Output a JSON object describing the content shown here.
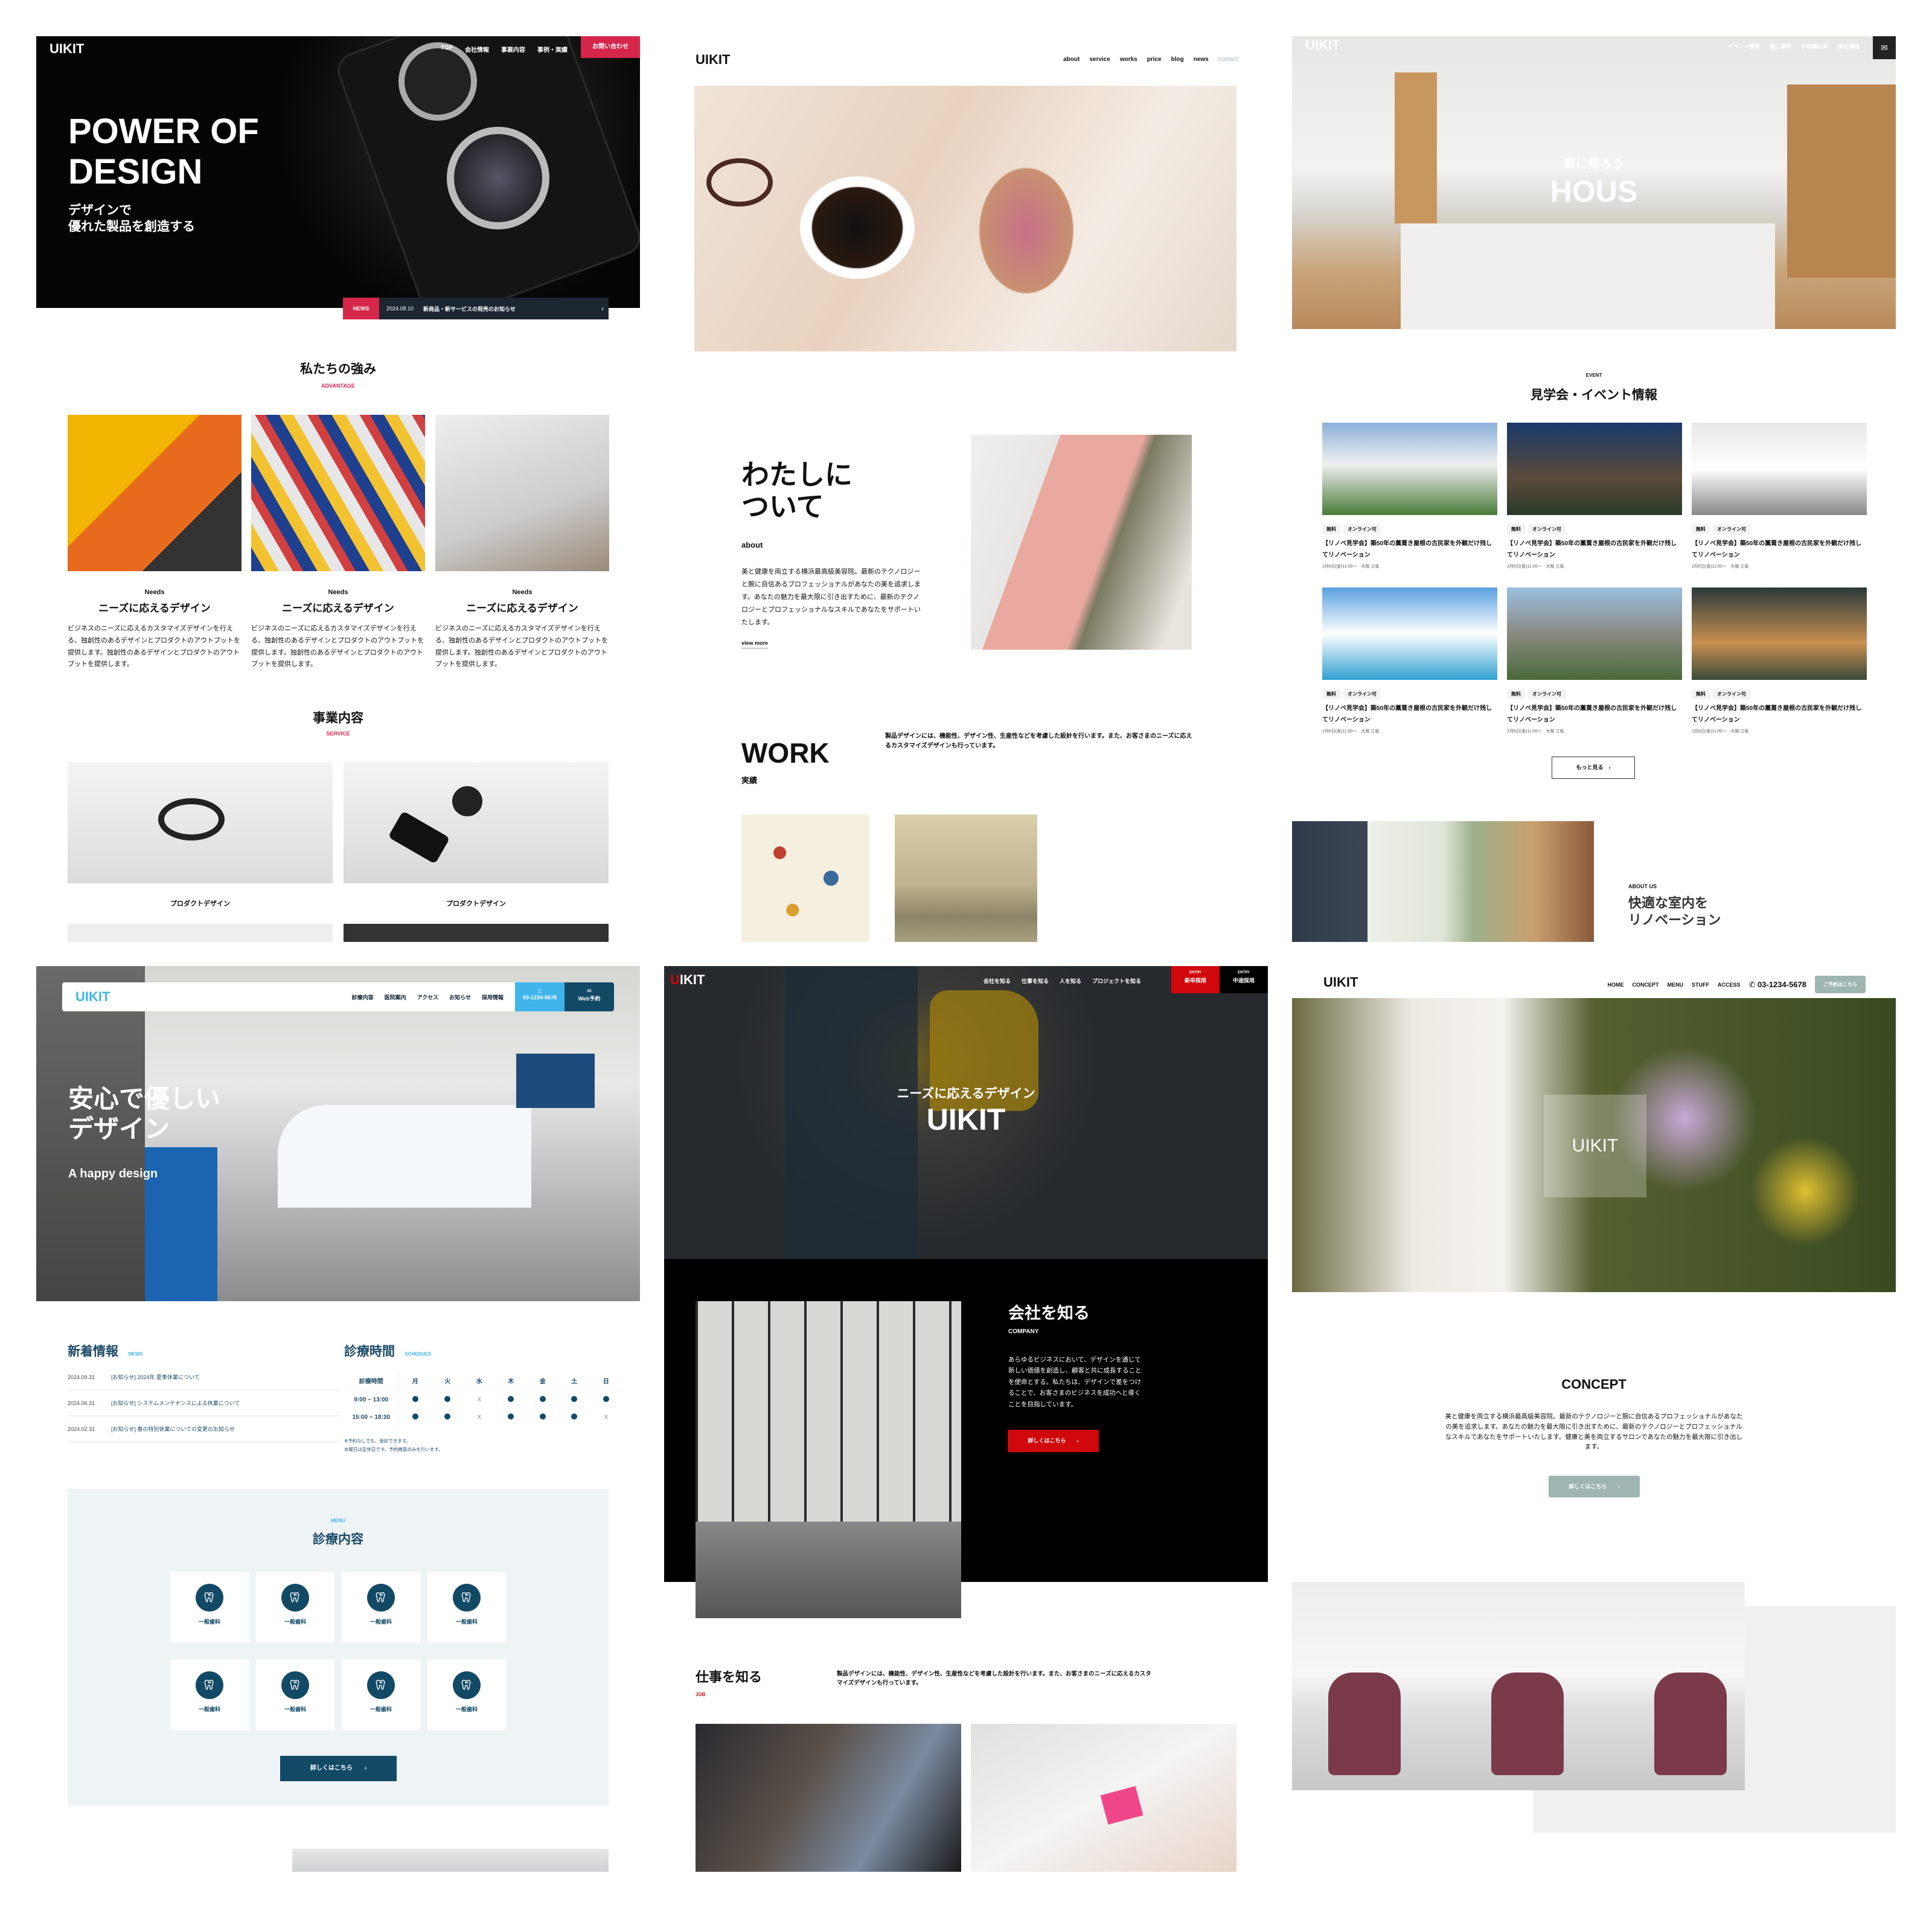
{
  "colors": {
    "red": "#d6264a",
    "clinic_blue": "#3fb4ec",
    "clinic_navy": "#124a66",
    "recruit_red": "#d0070b",
    "salon_green": "#9fb5b2"
  },
  "p1": {
    "logo": "UIKIT",
    "nav": [
      "TOP",
      "会社情報",
      "事業内容",
      "事例・実績"
    ],
    "contact": "お問い合わせ",
    "hero_title_1": "POWER OF",
    "hero_title_2": "DESIGN",
    "hero_sub_1": "デザインで",
    "hero_sub_2": "優れた製品を創造する",
    "news": {
      "label": "NEWS",
      "date": "2024.08.10",
      "text": "新商品・新サービスの発売のお知らせ",
      "arrow": "›"
    },
    "adv_title": "私たちの強み",
    "adv_en": "ADVANTAGE",
    "cards": [
      {
        "en": "Needs",
        "title": "ニーズに応えるデザイン",
        "body": "ビジネスのニーズに応えるカスタマイズデザインを行える、独創性のあるデザインとプロダクトのアウトプットを提供します。独創性のあるデザインとプロダクトのアウトプットを提供します。"
      },
      {
        "en": "Needs",
        "title": "ニーズに応えるデザイン",
        "body": "ビジネスのニーズに応えるカスタマイズデザインを行える、独創性のあるデザインとプロダクトのアウトプットを提供します。独創性のあるデザインとプロダクトのアウトプットを提供します。"
      },
      {
        "en": "Needs",
        "title": "ニーズに応えるデザイン",
        "body": "ビジネスのニーズに応えるカスタマイズデザインを行える、独創性のあるデザインとプロダクトのアウトプットを提供します。独創性のあるデザインとプロダクトのアウトプットを提供します。"
      }
    ],
    "service_title": "事業内容",
    "service_en": "SERVICE",
    "services": [
      "プロダクトデザイン",
      "プロダクトデザイン"
    ]
  },
  "p2": {
    "logo": "UIKIT",
    "nav": [
      "about",
      "service",
      "works",
      "price",
      "blog",
      "news",
      "contact"
    ],
    "about_title_1": "わたしに",
    "about_title_2": "ついて",
    "about_en": "about",
    "about_body": "美と健康を両立する横浜最高級美容院。最新のテクノロジーと腕に自信あるプロフェッショナルがあなたの美を追求します。あなたの魅力を最大限に引き出すために、最新のテクノロジーとプロフェッショナルなスキルであなたをサポートいたします。",
    "view_more": "view more",
    "work_title": "WORK",
    "work_ja": "実績",
    "work_desc": "製品デザインには、機能性、デザイン性、生産性などを考慮した設計を行います。また、お客さまのニーズに応えるカスタマイズデザインも行っています。"
  },
  "p3": {
    "logo": "UIKIT",
    "nav": [
      "イベント情報",
      "施工事例",
      "お客様の声",
      "会社情報"
    ],
    "mail_icon": "mail-icon",
    "hero_sub": "家に帰ろう",
    "hero_title": "HOUS",
    "event_en": "EVENT",
    "event_title": "見学会・イベント情報",
    "events": [
      {
        "tags": [
          "無料",
          "オンライン可"
        ],
        "title": "【リノベ見学会】築50年の藁葺き屋根の古民家を外観だけ残してリノベーション",
        "date": "2月6日(金)11:00〜　大阪 江坂"
      },
      {
        "tags": [
          "無料",
          "オンライン可"
        ],
        "title": "【リノベ見学会】築50年の藁葺き屋根の古民家を外観だけ残してリノベーション",
        "date": "2月6日(金)11:00〜　大阪 江坂"
      },
      {
        "tags": [
          "無料",
          "オンライン可"
        ],
        "title": "【リノベ見学会】築50年の藁葺き屋根の古民家を外観だけ残してリノベーション",
        "date": "2月6日(金)11:00〜　大阪 江坂"
      },
      {
        "tags": [
          "無料",
          "オンライン可"
        ],
        "title": "【リノベ見学会】築50年の藁葺き屋根の古民家を外観だけ残してリノベーション",
        "date": "2月6日(金)11:00〜　大阪 江坂"
      },
      {
        "tags": [
          "無料",
          "オンライン可"
        ],
        "title": "【リノベ見学会】築50年の藁葺き屋根の古民家を外観だけ残してリノベーション",
        "date": "2月6日(金)11:00〜　大阪 江坂"
      },
      {
        "tags": [
          "無料",
          "オンライン可"
        ],
        "title": "【リノベ見学会】築50年の藁葺き屋根の古民家を外観だけ残してリノベーション",
        "date": "2月6日(金)11:00〜　大阪 江坂"
      }
    ],
    "more": "もっと見る　›",
    "about_en": "ABOUT US",
    "about_title_1": "快適な室内を",
    "about_title_2": "リノベーション"
  },
  "p4": {
    "logo": "UIKIT",
    "nav": [
      "診療内容",
      "医院案内",
      "アクセス",
      "お知らせ",
      "採用情報"
    ],
    "phone": "03-1234-5678",
    "web": "Web予約",
    "hero_title_1": "安心で優しい",
    "hero_title_2": "デザイン",
    "hero_sub": "A happy design",
    "news_title": "新着情報",
    "news_en": "NEWS",
    "news": [
      {
        "date": "2024.09.31",
        "text": "[お知らせ] 2024年 夏季休業について"
      },
      {
        "date": "2024.06.31",
        "text": "[お知らせ] システムメンテナンスによる休業について"
      },
      {
        "date": "2024.02.31",
        "text": "[お知らせ] 春の特別休業についての変更のお知らせ"
      }
    ],
    "sched_title": "診療時間",
    "sched_en": "SCHEDULE",
    "sched_head": [
      "診療時間",
      "月",
      "火",
      "水",
      "木",
      "金",
      "土",
      "日"
    ],
    "sched_rows": [
      {
        "time": "9:00 ~ 13:00",
        "open": [
          true,
          true,
          false,
          true,
          true,
          true,
          true
        ]
      },
      {
        "time": "15:00 ~ 18:30",
        "open": [
          true,
          true,
          false,
          true,
          true,
          true,
          false
        ]
      }
    ],
    "closed_mark": "X",
    "note_1": "※予約なしでも、受診できます。",
    "note_2": "水曜日は定休日です。予約検査のみを行います。",
    "menu_en": "MENU",
    "menu_title": "診療内容",
    "menu_items": [
      "一般歯科",
      "一般歯科",
      "一般歯科",
      "一般歯科",
      "一般歯科",
      "一般歯科",
      "一般歯科",
      "一般歯科"
    ],
    "more": "詳しくはこちら　　›"
  },
  "p5": {
    "logo_u": "U",
    "logo_rest": "IKIT",
    "nav": [
      "会社を知る",
      "仕事を知る",
      "人を知る",
      "プロジェクトを知る"
    ],
    "entry_1": {
      "en": "ENTRY",
      "ja": "新卒採用"
    },
    "entry_2": {
      "en": "ENTRY",
      "ja": "中途採用"
    },
    "hero_sub": "ニーズに応えるデザイン",
    "hero_title": "UIKIT",
    "company_title": "会社を知る",
    "company_en": "COMPANY",
    "company_body": "あらゆるビジネスにおいて、デザインを通じて新しい価値を創造し、顧客と共に成長することを使命とする。私たちは、デザインで差をつけることで、お客さまのビジネスを成功へと導くことを目指しています。",
    "company_btn": "詳しくはこちら　　›",
    "job_title": "仕事を知る",
    "job_en": "JOB",
    "job_desc": "製品デザインには、機能性、デザイン性、生産性などを考慮した設計を行います。また、お客さまのニーズに応えるカスタマイズデザインも行っています。"
  },
  "p6": {
    "logo": "UIKIT",
    "nav": [
      "HOME",
      "CONCEPT",
      "MENU",
      "STUFF",
      "ACCESS"
    ],
    "phone": "03-1234-5678",
    "reserve": "ご予約はこちら",
    "hero_logo": "UIKIT",
    "concept_title": "CONCEPT",
    "concept_body": "美と健康を両立する横浜最高級美容院。最新のテクノロジーと腕に自信あるプロフェッショナルがあなたの美を追求します。あなたの魅力を最大限に引き出すために、最新のテクノロジーとプロフェッショナルなスキルであなたをサポートいたします。健康と美を両立するサロンであなたの魅力を最大限に引き出します。",
    "concept_btn": "詳しくはこちら　　›"
  }
}
